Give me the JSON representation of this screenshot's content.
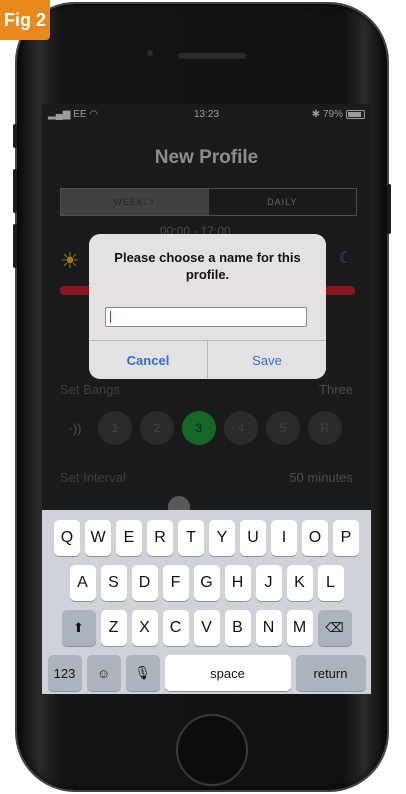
{
  "figure_label": "Fig 2",
  "status_bar": {
    "carrier": "EE",
    "time": "13:23",
    "battery": "79%"
  },
  "nav": {
    "title": "New Profile"
  },
  "segmented": {
    "weekly": "WEEKLY",
    "daily": "DAILY"
  },
  "schedule": {
    "time_range_partial": "00:00 - 17:00"
  },
  "bangs": {
    "label": "Set Bangs",
    "value": "Three",
    "options": [
      "1",
      "2",
      "3",
      "4",
      "5",
      "R"
    ],
    "selected": "3"
  },
  "interval": {
    "label": "Set Interval",
    "value": "50 minutes"
  },
  "alert": {
    "title": "Please choose a name for this profile.",
    "input_value": "",
    "cancel_label": "Cancel",
    "save_label": "Save"
  },
  "keyboard": {
    "row1": [
      "Q",
      "W",
      "E",
      "R",
      "T",
      "Y",
      "U",
      "I",
      "O",
      "P"
    ],
    "row2": [
      "A",
      "S",
      "D",
      "F",
      "G",
      "H",
      "J",
      "K",
      "L"
    ],
    "row3": [
      "Z",
      "X",
      "C",
      "V",
      "B",
      "N",
      "M"
    ],
    "numbers_label": "123",
    "space_label": "space",
    "return_label": "return"
  },
  "colors": {
    "accent_red": "#b81f2a",
    "selected_green": "#1f8a33",
    "link_blue": "#2f6fd9"
  }
}
